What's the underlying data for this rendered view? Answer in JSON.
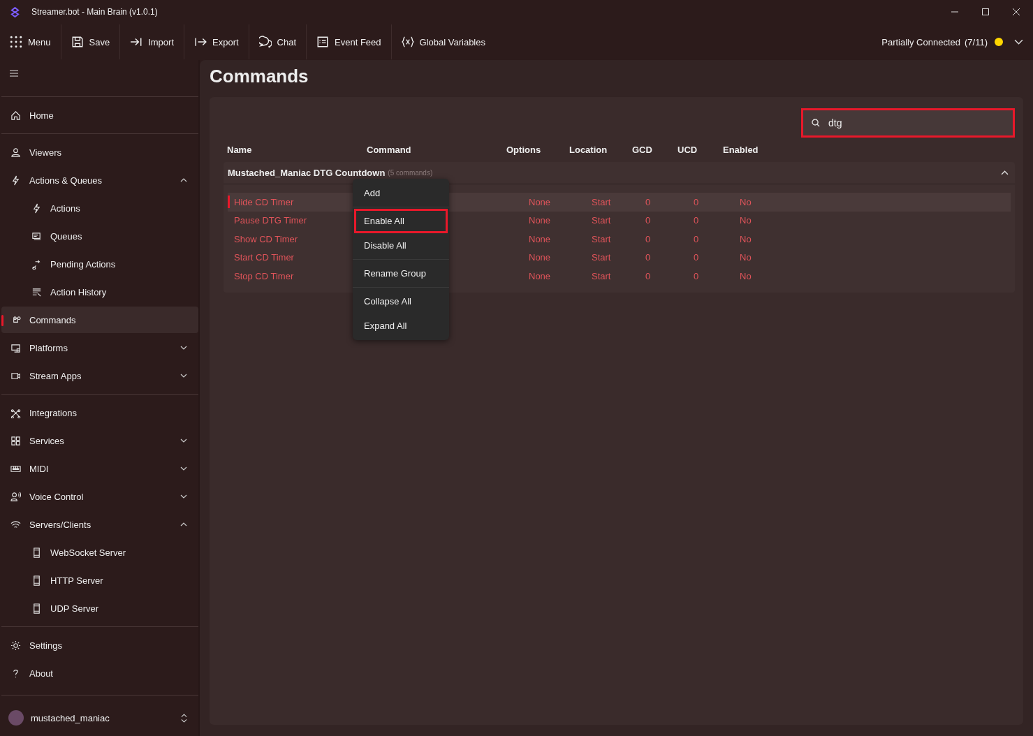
{
  "window": {
    "title": "Streamer.bot - Main Brain (v1.0.1)"
  },
  "toolbar": {
    "items": [
      {
        "label": "Menu"
      },
      {
        "label": "Save"
      },
      {
        "label": "Import"
      },
      {
        "label": "Export"
      },
      {
        "label": "Chat"
      },
      {
        "label": "Event Feed"
      },
      {
        "label": "Global Variables"
      }
    ],
    "connection": {
      "status": "Partially Connected",
      "count": "(7/11)",
      "color": "#ffd600"
    }
  },
  "sidebar": {
    "sections": [
      [
        {
          "label": "Home",
          "selected": false
        }
      ],
      [
        {
          "label": "Viewers",
          "selected": false
        },
        {
          "label": "Actions & Queues",
          "expanded": true,
          "selected": false,
          "children": [
            {
              "label": "Actions",
              "selected": false
            },
            {
              "label": "Queues",
              "selected": false
            },
            {
              "label": "Pending Actions",
              "selected": false
            },
            {
              "label": "Action History",
              "selected": false
            }
          ]
        },
        {
          "label": "Commands",
          "selected": true
        },
        {
          "label": "Platforms",
          "expanded": false,
          "selected": false
        },
        {
          "label": "Stream Apps",
          "expanded": false,
          "selected": false
        }
      ],
      [
        {
          "label": "Integrations",
          "selected": false
        },
        {
          "label": "Services",
          "expanded": false,
          "selected": false
        },
        {
          "label": "MIDI",
          "expanded": false,
          "selected": false
        },
        {
          "label": "Voice Control",
          "expanded": false,
          "selected": false
        },
        {
          "label": "Servers/Clients",
          "expanded": true,
          "selected": false,
          "children": [
            {
              "label": "WebSocket Server",
              "selected": false
            },
            {
              "label": "HTTP Server",
              "selected": false
            },
            {
              "label": "UDP Server",
              "selected": false
            }
          ]
        }
      ],
      [
        {
          "label": "Settings",
          "selected": false
        },
        {
          "label": "About",
          "selected": false
        }
      ]
    ],
    "user": {
      "name": "mustached_maniac"
    }
  },
  "page": {
    "title": "Commands"
  },
  "search": {
    "value": "dtg",
    "highlighted": true
  },
  "table": {
    "columns": [
      "Name",
      "Command",
      "Options",
      "Location",
      "GCD",
      "UCD",
      "Enabled"
    ],
    "group": {
      "name": "Mustached_Maniac DTG Countdown",
      "count": "(5 commands)",
      "expanded": true
    },
    "rows": [
      {
        "name": "Hide CD Timer",
        "options": "None",
        "location": "Start",
        "gcd": "0",
        "ucd": "0",
        "enabled_text": "No",
        "enabled": false,
        "selected": true
      },
      {
        "name": "Pause DTG Timer",
        "options": "None",
        "location": "Start",
        "gcd": "0",
        "ucd": "0",
        "enabled_text": "No",
        "enabled": false,
        "selected": false
      },
      {
        "name": "Show CD Timer",
        "options": "None",
        "location": "Start",
        "gcd": "0",
        "ucd": "0",
        "enabled_text": "No",
        "enabled": false,
        "selected": false
      },
      {
        "name": "Start CD Timer",
        "options": "None",
        "location": "Start",
        "gcd": "0",
        "ucd": "0",
        "enabled_text": "No",
        "enabled": false,
        "selected": false
      },
      {
        "name": "Stop CD Timer",
        "options": "None",
        "location": "Start",
        "gcd": "0",
        "ucd": "0",
        "enabled_text": "No",
        "enabled": false,
        "selected": false
      }
    ]
  },
  "context_menu": {
    "sections": [
      [
        {
          "label": "Add",
          "highlighted": false
        }
      ],
      [
        {
          "label": "Enable All",
          "highlighted": true
        },
        {
          "label": "Disable All",
          "highlighted": false
        }
      ],
      [
        {
          "label": "Rename Group",
          "highlighted": false
        }
      ],
      [
        {
          "label": "Collapse All",
          "highlighted": false
        },
        {
          "label": "Expand All",
          "highlighted": false
        }
      ]
    ]
  }
}
